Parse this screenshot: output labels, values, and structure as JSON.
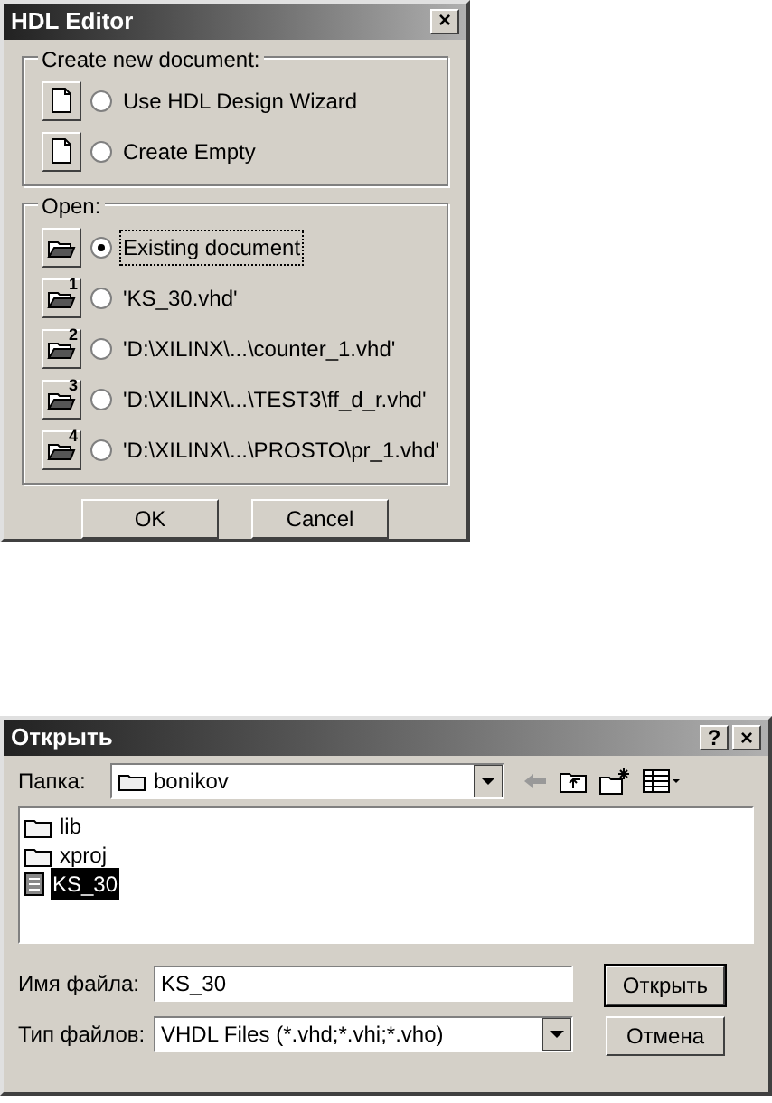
{
  "hdl_editor": {
    "title": "HDL Editor",
    "close": "×",
    "create_group": {
      "label": "Create new document:",
      "options": [
        {
          "label": "Use HDL Design Wizard",
          "selected": false,
          "kind": "document"
        },
        {
          "label": "Create Empty",
          "selected": false,
          "kind": "document"
        }
      ]
    },
    "open_group": {
      "label": "Open:",
      "options": [
        {
          "label": "Existing document",
          "selected": true,
          "kind": "folder"
        },
        {
          "label": "'KS_30.vhd'",
          "selected": false,
          "kind": "folder",
          "badge": "1"
        },
        {
          "label": "'D:\\XILINX\\...\\counter_1.vhd'",
          "selected": false,
          "kind": "folder",
          "badge": "2"
        },
        {
          "label": "'D:\\XILINX\\...\\TEST3\\ff_d_r.vhd'",
          "selected": false,
          "kind": "folder",
          "badge": "3"
        },
        {
          "label": "'D:\\XILINX\\...\\PROSTO\\pr_1.vhd'",
          "selected": false,
          "kind": "folder",
          "badge": "4"
        }
      ]
    },
    "buttons": [
      "OK",
      "Cancel"
    ]
  },
  "open_dialog": {
    "title": "Открыть",
    "help": "?",
    "close": "×",
    "folder_label": "Папка:",
    "folder": "bonikov",
    "files": [
      {
        "name": "lib",
        "kind": "folder",
        "selected": false
      },
      {
        "name": "xproj",
        "kind": "folder",
        "selected": false
      },
      {
        "name": "KS_30",
        "kind": "file",
        "selected": true
      }
    ],
    "filename_label": "Имя файла:",
    "filename": "KS_30",
    "filetype_label": "Тип файлов:",
    "filetype": "VHDL Files (*.vhd;*.vhi;*.vho)",
    "buttons": [
      "Открыть",
      "Отмена"
    ]
  }
}
